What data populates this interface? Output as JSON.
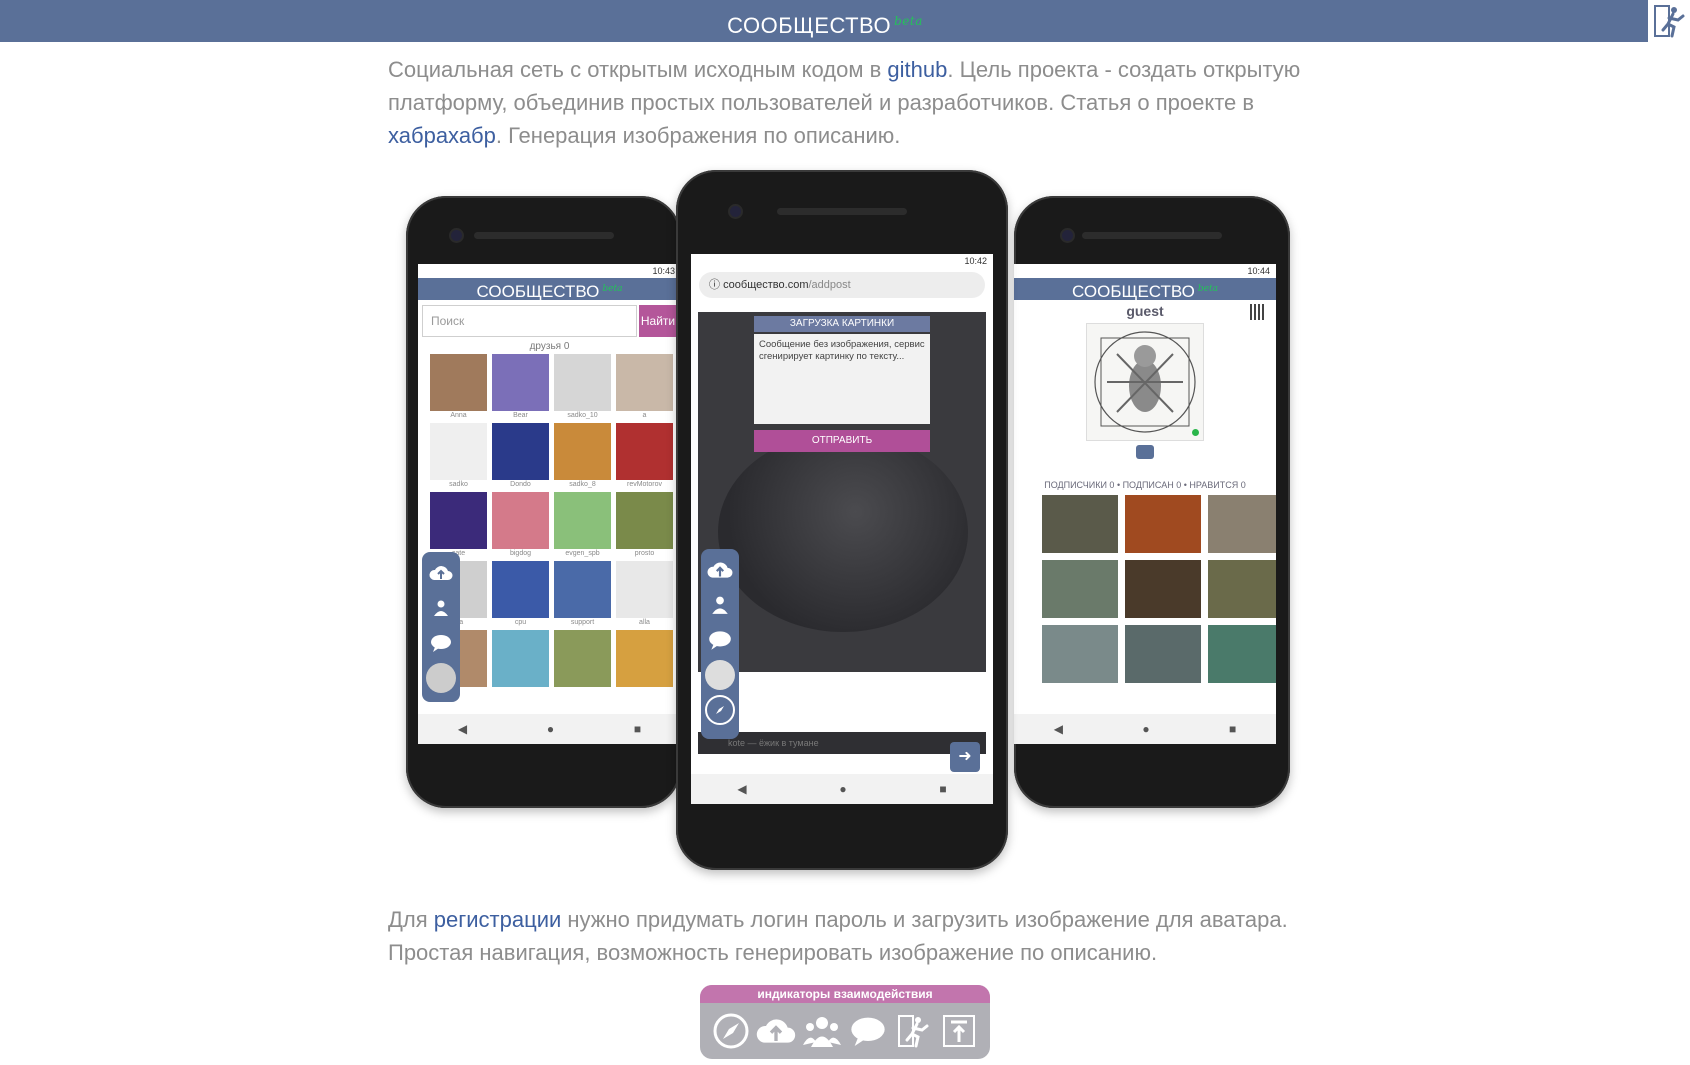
{
  "header": {
    "title": "СООБЩЕСТВО",
    "beta": "beta",
    "exit_icon": "exit-icon"
  },
  "intro": {
    "p1": "Социальная сеть с открытым исходным кодом в ",
    "link_github": "github",
    "p2": ". Цель проекта - создать открытую платформу, объединив простых пользователей и разработчиков. Статья о проекте в ",
    "link_habr": "хабрахабр",
    "p3": ". Генерация изображения по описанию."
  },
  "phone_left": {
    "time": "10:43",
    "app_title": "СООБЩЕСТВО",
    "beta": "beta",
    "search_placeholder": "Поиск",
    "search_button": "Найти",
    "friends_label": "друзья 0",
    "users": [
      "Anna",
      "Bear",
      "sadko_10",
      "a",
      "sadko",
      "Dondo",
      "sadko_8",
      "revMotorov",
      "cate",
      "bigdog",
      "evgen_spb",
      "prosto",
      "ina",
      "cpu",
      "support",
      "alla",
      "",
      "",
      "",
      ""
    ]
  },
  "phone_middle": {
    "time": "10:42",
    "url_host": "сообщество.com",
    "url_path": "/addpost",
    "modal_title": "ЗАГРУЗКА КАРТИНКИ",
    "modal_text": "Сообщение без изображения, сервис сгенирирует картинку по тексту...",
    "send_button": "ОТПРАВИТЬ",
    "ghost_user": "kote",
    "ghost_post": "kote — ёжик в тумане"
  },
  "phone_right": {
    "time": "10:44",
    "app_title": "СООБЩЕСТВО",
    "beta": "beta",
    "username": "guest",
    "stats": "ПОДПИСЧИКИ 0 • ПОДПИСАН 0 • НРАВИТСЯ 0"
  },
  "registration": {
    "p1": "Для ",
    "link_reg": "регистрации",
    "p2": " нужно придумать логин пароль и загрузить изображение для аватара. Простая навигация, возможность генерировать изображение по описанию."
  },
  "indicators": {
    "title": "индикаторы взаимодействия",
    "icons": [
      "compass-icon",
      "upload-cloud-icon",
      "people-icon",
      "chat-icon",
      "exit-icon",
      "scroll-top-icon"
    ]
  },
  "colors": {
    "brand": "#5a7098",
    "accent": "#b4569a",
    "link": "#3d5fa0",
    "beta": "#24c25a"
  }
}
